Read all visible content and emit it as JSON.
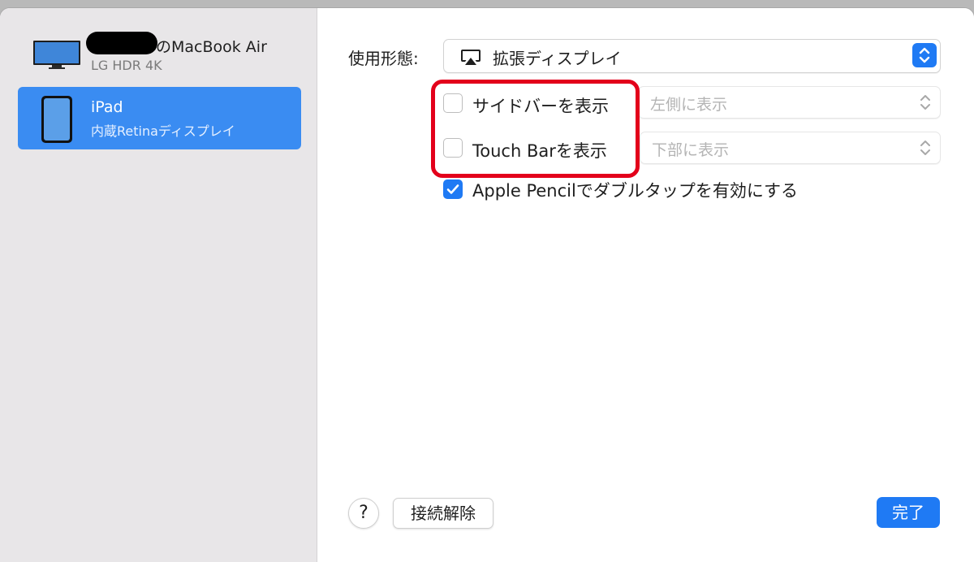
{
  "sidebar": {
    "devices": [
      {
        "name": "のMacBook Air",
        "sub": "LG HDR 4K",
        "icon": "monitor-icon"
      },
      {
        "name": "iPad",
        "sub": "内蔵Retinaディスプレイ",
        "icon": "ipad-icon"
      }
    ]
  },
  "main": {
    "mode_label": "使用形態:",
    "mode_value": "拡張ディスプレイ",
    "show_sidebar_label": "サイドバーを表示",
    "show_sidebar_checked": false,
    "sidebar_position": "左側に表示",
    "show_touchbar_label": "Touch Barを表示",
    "show_touchbar_checked": false,
    "touchbar_position": "下部に表示",
    "pencil_label": "Apple Pencilでダブルタップを有効にする",
    "pencil_checked": true
  },
  "footer": {
    "help_label": "?",
    "disconnect_label": "接続解除",
    "done_label": "完了"
  },
  "colors": {
    "accent": "#1f7af4",
    "selection": "#3a8cf2",
    "highlight": "#e3001b",
    "sidebar_bg": "#e8e6e8"
  }
}
